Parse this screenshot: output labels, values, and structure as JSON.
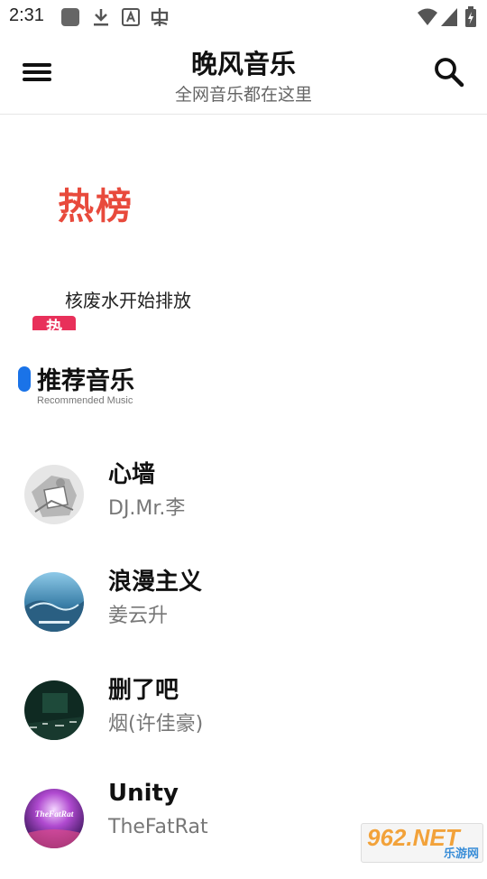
{
  "status_bar": {
    "time": "2:31",
    "left_icons": [
      "square-icon",
      "download-icon",
      "text-a-icon",
      "bug-icon"
    ],
    "right_icons": [
      "wifi-icon",
      "signal-icon",
      "battery-icon"
    ]
  },
  "app_bar": {
    "title": "晚风音乐",
    "subtitle": "全网音乐都在这里"
  },
  "hot_chart": {
    "logo_text": "热榜",
    "headline": "核废水开始排放",
    "badge_text": "热"
  },
  "section": {
    "title": "推荐音乐",
    "subtitle": "Recommended Music",
    "accent_color": "#1a73e8"
  },
  "songs": [
    {
      "title": "心墙",
      "artist": "DJ.Mr.李",
      "cover": "sketch-gray"
    },
    {
      "title": "浪漫主义",
      "artist": "姜云升",
      "cover": "ocean-blue"
    },
    {
      "title": "删了吧",
      "artist": "烟(许佳豪)",
      "cover": "dark-green"
    },
    {
      "title": "Unity",
      "artist": "TheFatRat",
      "cover": "purple-galaxy",
      "cover_text": "TheFatRat"
    }
  ],
  "watermark": {
    "main": "962.NET",
    "sub": "乐游网"
  }
}
